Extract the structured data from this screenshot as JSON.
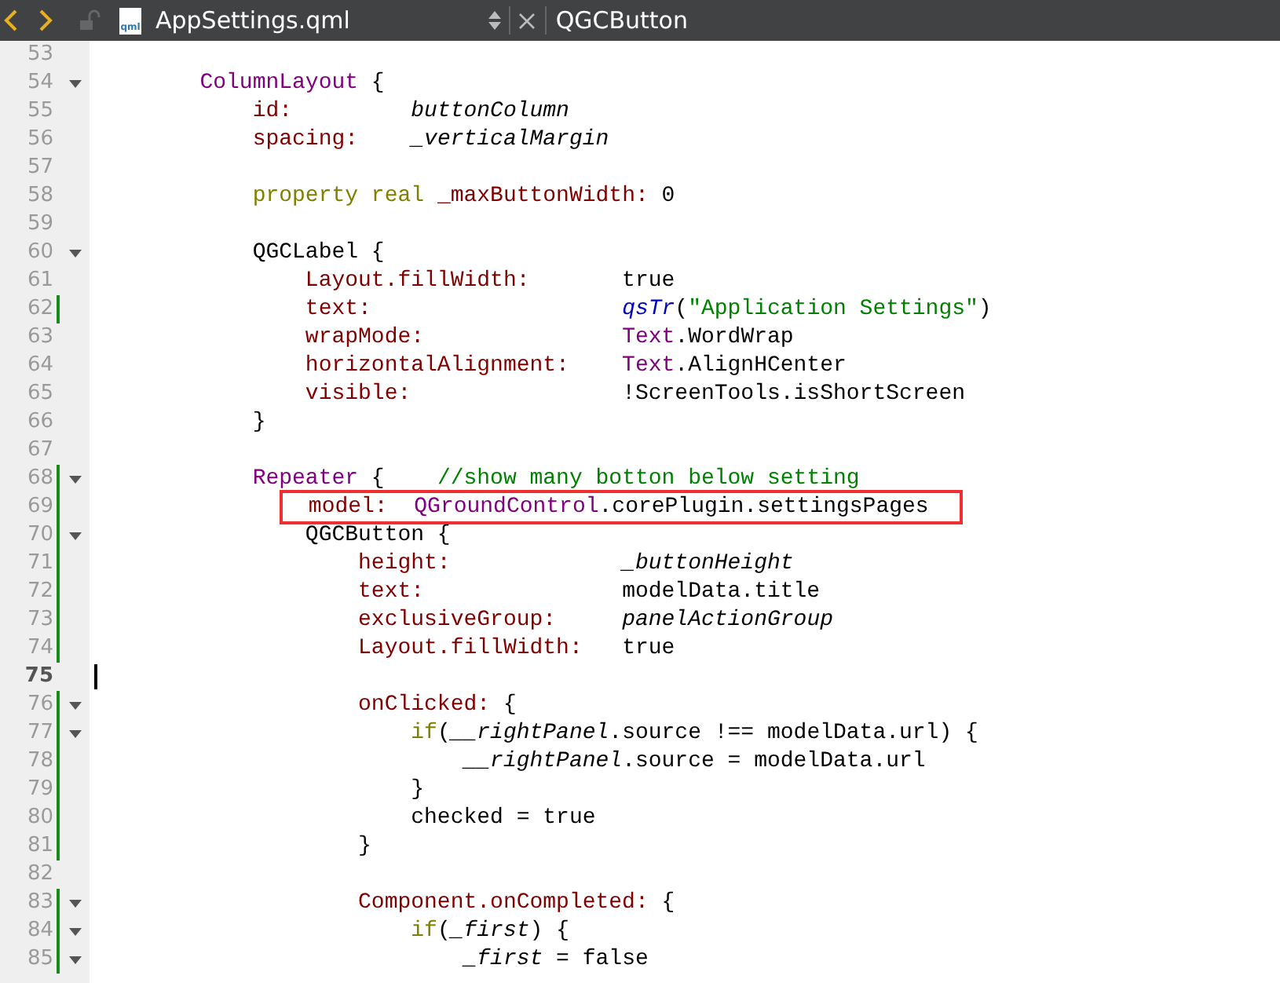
{
  "toolbar": {
    "file_name": "AppSettings.qml",
    "file_type": "qml",
    "symbol": "QGCButton"
  },
  "lines": [
    {
      "number": "53",
      "fold": false,
      "changed": false,
      "current": false
    },
    {
      "number": "54",
      "fold": true,
      "changed": false,
      "current": false,
      "tokens": [
        {
          "kind": "type",
          "text": "        ColumnLayout"
        },
        {
          "kind": "plain",
          "text": " {"
        }
      ]
    },
    {
      "number": "55",
      "fold": false,
      "changed": false,
      "current": false,
      "tokens": [
        {
          "kind": "prop",
          "text": "            id:"
        },
        {
          "kind": "italic",
          "text": "         buttonColumn"
        }
      ]
    },
    {
      "number": "56",
      "fold": false,
      "changed": false,
      "current": false,
      "tokens": [
        {
          "kind": "prop",
          "text": "            spacing:"
        },
        {
          "kind": "italic",
          "text": "    _verticalMargin"
        }
      ]
    },
    {
      "number": "57",
      "fold": false,
      "changed": false,
      "current": false
    },
    {
      "number": "58",
      "fold": false,
      "changed": false,
      "current": false,
      "tokens": [
        {
          "kind": "keyword",
          "text": "            property real"
        },
        {
          "kind": "prop",
          "text": " _maxButtonWidth:"
        },
        {
          "kind": "plain",
          "text": " 0"
        }
      ]
    },
    {
      "number": "59",
      "fold": false,
      "changed": false,
      "current": false
    },
    {
      "number": "60",
      "fold": true,
      "changed": false,
      "current": false,
      "tokens": [
        {
          "kind": "plain",
          "text": "            QGCLabel {"
        }
      ]
    },
    {
      "number": "61",
      "fold": false,
      "changed": false,
      "current": false,
      "tokens": [
        {
          "kind": "prop",
          "text": "                Layout.fillWidth:"
        },
        {
          "kind": "plain",
          "text": "       true"
        }
      ]
    },
    {
      "number": "62",
      "fold": false,
      "changed": true,
      "current": false,
      "tokens": [
        {
          "kind": "prop",
          "text": "                text:"
        },
        {
          "kind": "func",
          "text": "                   qsTr"
        },
        {
          "kind": "plain",
          "text": "("
        },
        {
          "kind": "string",
          "text": "\"Application Settings\""
        },
        {
          "kind": "plain",
          "text": ")"
        }
      ]
    },
    {
      "number": "63",
      "fold": false,
      "changed": false,
      "current": false,
      "tokens": [
        {
          "kind": "prop",
          "text": "                wrapMode:"
        },
        {
          "kind": "type",
          "text": "               Text"
        },
        {
          "kind": "plain",
          "text": ".WordWrap"
        }
      ]
    },
    {
      "number": "64",
      "fold": false,
      "changed": false,
      "current": false,
      "tokens": [
        {
          "kind": "prop",
          "text": "                horizontalAlignment:"
        },
        {
          "kind": "type",
          "text": "    Text"
        },
        {
          "kind": "plain",
          "text": ".AlignHCenter"
        }
      ]
    },
    {
      "number": "65",
      "fold": false,
      "changed": false,
      "current": false,
      "tokens": [
        {
          "kind": "prop",
          "text": "                visible:"
        },
        {
          "kind": "plain",
          "text": "                !ScreenTools.isShortScreen"
        }
      ]
    },
    {
      "number": "66",
      "fold": false,
      "changed": false,
      "current": false,
      "tokens": [
        {
          "kind": "plain",
          "text": "            }"
        }
      ]
    },
    {
      "number": "67",
      "fold": false,
      "changed": false,
      "current": false
    },
    {
      "number": "68",
      "fold": true,
      "changed": true,
      "current": false,
      "tokens": [
        {
          "kind": "type",
          "text": "            Repeater"
        },
        {
          "kind": "plain",
          "text": " {"
        },
        {
          "kind": "comment",
          "text": "    //show many botton below setting"
        }
      ]
    },
    {
      "number": "69",
      "fold": false,
      "changed": true,
      "current": false,
      "boxed": true,
      "tokens": [
        {
          "kind": "prop",
          "text": "                model:"
        },
        {
          "kind": "type",
          "text": "  QGroundControl"
        },
        {
          "kind": "plain",
          "text": ".corePlugin.settingsPages"
        }
      ]
    },
    {
      "number": "70",
      "fold": true,
      "changed": true,
      "current": false,
      "tokens": [
        {
          "kind": "plain",
          "text": "                QGCButton {"
        }
      ]
    },
    {
      "number": "71",
      "fold": false,
      "changed": true,
      "current": false,
      "tokens": [
        {
          "kind": "prop",
          "text": "                    height:"
        },
        {
          "kind": "italic",
          "text": "             _buttonHeight"
        }
      ]
    },
    {
      "number": "72",
      "fold": false,
      "changed": true,
      "current": false,
      "tokens": [
        {
          "kind": "prop",
          "text": "                    text:"
        },
        {
          "kind": "plain",
          "text": "               modelData.title"
        }
      ]
    },
    {
      "number": "73",
      "fold": false,
      "changed": true,
      "current": false,
      "tokens": [
        {
          "kind": "prop",
          "text": "                    exclusiveGroup:"
        },
        {
          "kind": "italic",
          "text": "     panelActionGroup"
        }
      ]
    },
    {
      "number": "74",
      "fold": false,
      "changed": true,
      "current": false,
      "tokens": [
        {
          "kind": "prop",
          "text": "                    Layout.fillWidth:"
        },
        {
          "kind": "plain",
          "text": "   true"
        }
      ]
    },
    {
      "number": "75",
      "fold": false,
      "changed": false,
      "current": true
    },
    {
      "number": "76",
      "fold": true,
      "changed": true,
      "current": false,
      "tokens": [
        {
          "kind": "prop",
          "text": "                    onClicked:"
        },
        {
          "kind": "plain",
          "text": " {"
        }
      ]
    },
    {
      "number": "77",
      "fold": true,
      "changed": true,
      "current": false,
      "tokens": [
        {
          "kind": "keyword",
          "text": "                        if"
        },
        {
          "kind": "plain",
          "text": "("
        },
        {
          "kind": "italic",
          "text": "__rightPanel"
        },
        {
          "kind": "plain",
          "text": ".source !== modelData.url) {"
        }
      ]
    },
    {
      "number": "78",
      "fold": false,
      "changed": true,
      "current": false,
      "tokens": [
        {
          "kind": "italic",
          "text": "                            __rightPanel"
        },
        {
          "kind": "plain",
          "text": ".source = modelData.url"
        }
      ]
    },
    {
      "number": "79",
      "fold": false,
      "changed": true,
      "current": false,
      "tokens": [
        {
          "kind": "plain",
          "text": "                        }"
        }
      ]
    },
    {
      "number": "80",
      "fold": false,
      "changed": true,
      "current": false,
      "tokens": [
        {
          "kind": "plain",
          "text": "                        checked = true"
        }
      ]
    },
    {
      "number": "81",
      "fold": false,
      "changed": true,
      "current": false,
      "tokens": [
        {
          "kind": "plain",
          "text": "                    }"
        }
      ]
    },
    {
      "number": "82",
      "fold": false,
      "changed": false,
      "current": false
    },
    {
      "number": "83",
      "fold": true,
      "changed": true,
      "current": false,
      "tokens": [
        {
          "kind": "prop",
          "text": "                    Component.onCompleted:"
        },
        {
          "kind": "plain",
          "text": " {"
        }
      ]
    },
    {
      "number": "84",
      "fold": true,
      "changed": true,
      "current": false,
      "tokens": [
        {
          "kind": "keyword",
          "text": "                        if"
        },
        {
          "kind": "plain",
          "text": "("
        },
        {
          "kind": "italic",
          "text": "_first"
        },
        {
          "kind": "plain",
          "text": ") {"
        }
      ]
    },
    {
      "number": "85",
      "fold": true,
      "changed": true,
      "current": false,
      "tokens": [
        {
          "kind": "italic",
          "text": "                            _first"
        },
        {
          "kind": "plain",
          "text": " = false"
        }
      ]
    }
  ]
}
